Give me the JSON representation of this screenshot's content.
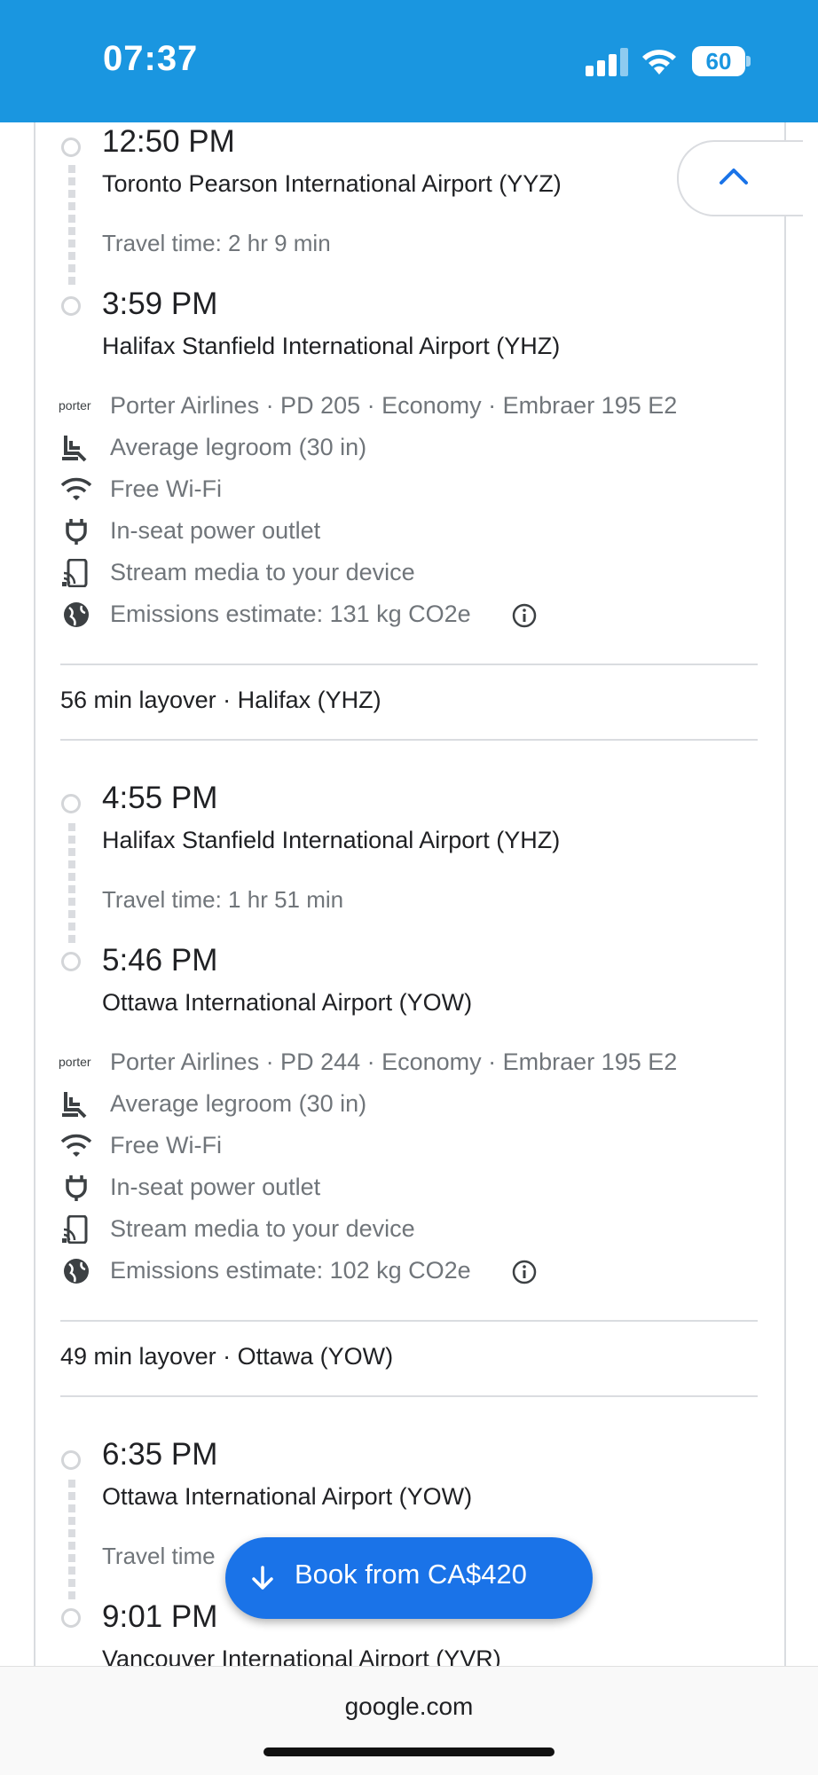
{
  "status_bar": {
    "time": "07:37",
    "battery": "60"
  },
  "segments": [
    {
      "dep_time": "12:50 PM",
      "dep_airport": "Toronto Pearson International Airport (YYZ)",
      "travel_time": "Travel time: 2 hr 9 min",
      "arr_time": "3:59 PM",
      "arr_airport": "Halifax Stanfield International Airport (YHZ)",
      "airline_logo": "porter",
      "flight_info": "Porter Airlines · PD 205 · Economy · Embraer 195 E2",
      "legroom": "Average legroom (30 in)",
      "wifi": "Free Wi-Fi",
      "power": "In-seat power outlet",
      "stream": "Stream media to your device",
      "emissions": "Emissions estimate: 131 kg CO2e"
    },
    {
      "dep_time": "4:55 PM",
      "dep_airport": "Halifax Stanfield International Airport (YHZ)",
      "travel_time": "Travel time: 1 hr 51 min",
      "arr_time": "5:46 PM",
      "arr_airport": "Ottawa International Airport (YOW)",
      "airline_logo": "porter",
      "flight_info": "Porter Airlines · PD 244 · Economy · Embraer 195 E2",
      "legroom": "Average legroom (30 in)",
      "wifi": "Free Wi-Fi",
      "power": "In-seat power outlet",
      "stream": "Stream media to your device",
      "emissions": "Emissions estimate: 102 kg CO2e"
    },
    {
      "dep_time": "6:35 PM",
      "dep_airport": "Ottawa International Airport (YOW)",
      "travel_time": "Travel time",
      "arr_time": "9:01 PM",
      "arr_airport": "Vancouver International Airport (YVR)"
    }
  ],
  "layovers": [
    "56 min layover · Halifax (YHZ)",
    "49 min layover · Ottawa (YOW)"
  ],
  "book_button": {
    "label": "Book from CA$420"
  },
  "browser": {
    "url": "google.com"
  },
  "colors": {
    "accent": "#1a73e8",
    "status_bar": "#1a96e0",
    "muted_text": "#70757a"
  }
}
